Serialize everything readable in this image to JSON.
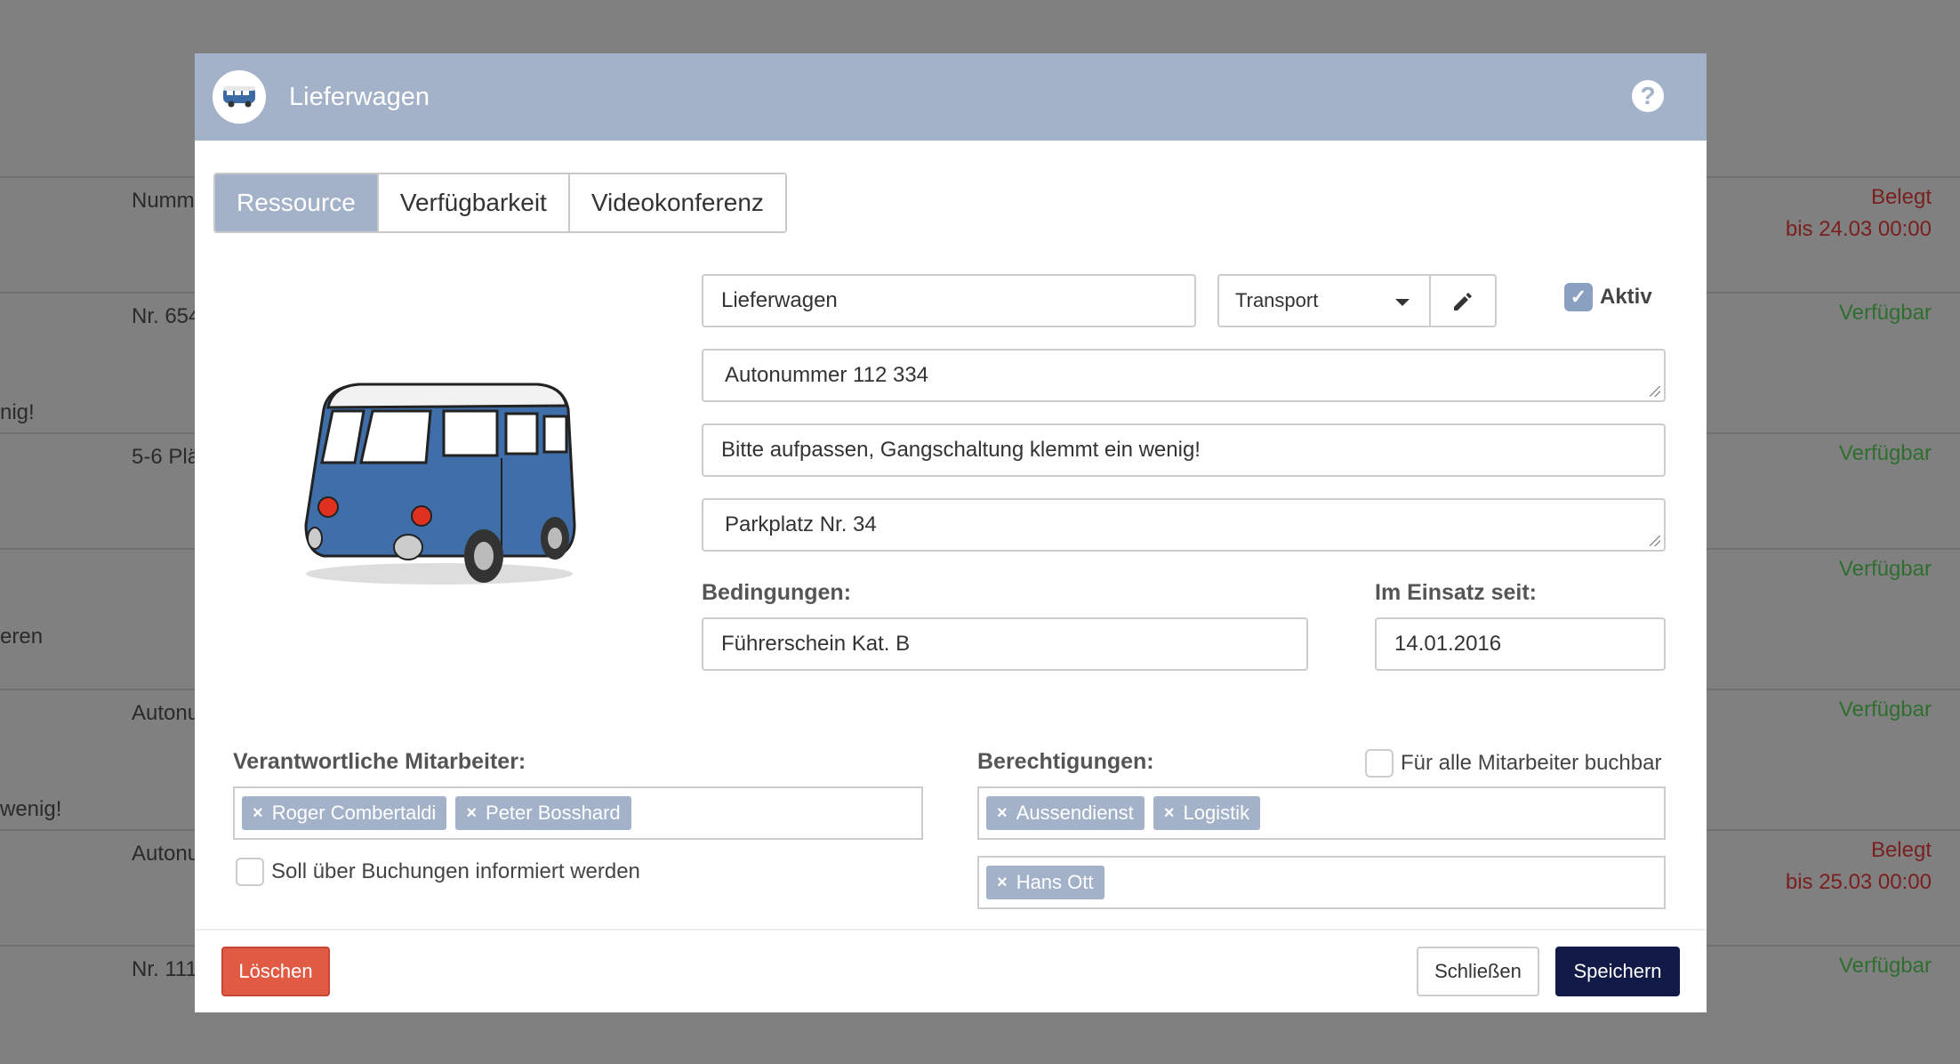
{
  "background": {
    "left_fragments": [
      "Numm",
      "Nr. 654",
      "nig!",
      "5-6 Plä",
      "eren",
      "Autonu",
      "wenig!",
      "Autonu",
      "Nr. 111"
    ],
    "statuses": [
      {
        "text": "Belegt",
        "type": "busy"
      },
      {
        "text": "bis 24.03 00:00",
        "type": "busy"
      },
      {
        "text": "Verfügbar",
        "type": "free"
      },
      {
        "text": "Verfügbar",
        "type": "free"
      },
      {
        "text": "Verfügbar",
        "type": "free"
      },
      {
        "text": "Verfügbar",
        "type": "free"
      },
      {
        "text": "Belegt",
        "type": "busy"
      },
      {
        "text": "bis 25.03 00:00",
        "type": "busy"
      },
      {
        "text": "Verfügbar",
        "type": "free"
      }
    ]
  },
  "modal": {
    "title": "Lieferwagen",
    "help_glyph": "?",
    "tabs": [
      {
        "label": "Ressource",
        "active": true
      },
      {
        "label": "Verfügbarkeit",
        "active": false
      },
      {
        "label": "Videokonferenz",
        "active": false
      }
    ],
    "fields": {
      "name": "Lieferwagen",
      "category": "Transport",
      "aktiv_label": "Aktiv",
      "aktiv_checked": true,
      "number": "Autonummer 112 334",
      "note": "Bitte aufpassen, Gangschaltung klemmt ein wenig!",
      "location": "Parkplatz Nr. 34",
      "conditions_label": "Bedingungen:",
      "conditions": "Führerschein Kat. B",
      "since_label": "Im Einsatz seit:",
      "since": "14.01.2016"
    },
    "responsible": {
      "label": "Verantwortliche Mitarbeiter:",
      "tags": [
        "Roger Combertaldi",
        "Peter Bosshard"
      ],
      "notify_label": "Soll über Buchungen informiert werden"
    },
    "permissions": {
      "label": "Berechtigungen:",
      "all_label": "Für alle Mitarbeiter buchbar",
      "groups": [
        "Aussendienst",
        "Logistik"
      ],
      "people": [
        "Hans Ott"
      ]
    },
    "buttons": {
      "delete": "Löschen",
      "close": "Schließen",
      "save": "Speichern"
    },
    "colors": {
      "header": "#a3b2c9",
      "delete": "#e05a44",
      "save": "#121a47"
    }
  }
}
